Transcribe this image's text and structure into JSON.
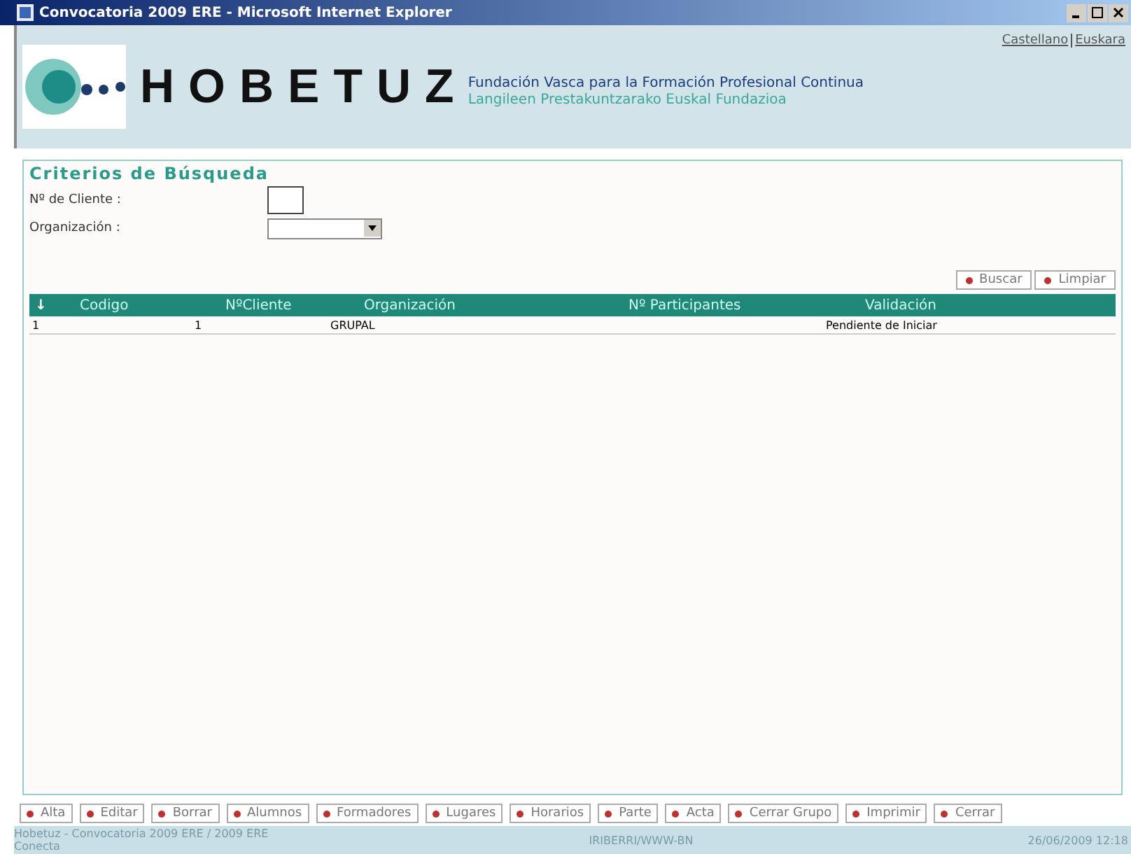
{
  "window": {
    "title": "Convocatoria 2009 ERE - Microsoft Internet Explorer"
  },
  "header": {
    "language_links": [
      "Castellano",
      "Euskara"
    ],
    "brand": "HOBETUZ",
    "tagline_1": "Fundación Vasca para la Formación Profesional Continua",
    "tagline_2": "Langileen Prestakuntzarako Euskal Fundazioa"
  },
  "search": {
    "title": "Criterios de Búsqueda",
    "fields": [
      {
        "label": "Nº de Cliente :",
        "kind": "text"
      },
      {
        "label": "Organización :",
        "kind": "select"
      }
    ],
    "buttons": [
      "Buscar",
      "Limpiar"
    ]
  },
  "table": {
    "sort_icon": "↓",
    "columns": [
      "Codigo",
      "NºCliente",
      "Organización",
      "Nº Participantes",
      "Validación"
    ],
    "rows": [
      [
        "1",
        "1",
        "GRUPAL",
        "",
        "Pendiente de Iniciar"
      ]
    ]
  },
  "actions": [
    "Alta",
    "Editar",
    "Borrar",
    "Alumnos",
    "Formadores",
    "Lugares",
    "Horarios",
    "Parte",
    "Acta",
    "Cerrar Grupo",
    "Imprimir",
    "Cerrar"
  ],
  "status_bar": {
    "left_1": "Hobetuz - Convocatoria 2009 ERE / 2009 ERE",
    "left_2": "Conecta",
    "center": "IRIBERRI/WWW-BN",
    "right": "26/06/2009 12:18"
  }
}
